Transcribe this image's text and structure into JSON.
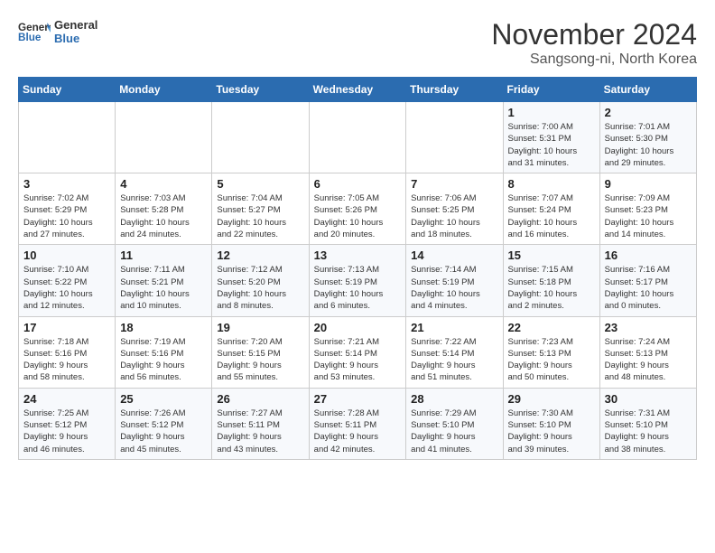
{
  "logo": {
    "line1": "General",
    "line2": "Blue"
  },
  "title": "November 2024",
  "location": "Sangsong-ni, North Korea",
  "days_of_week": [
    "Sunday",
    "Monday",
    "Tuesday",
    "Wednesday",
    "Thursday",
    "Friday",
    "Saturday"
  ],
  "weeks": [
    [
      {
        "day": "",
        "info": ""
      },
      {
        "day": "",
        "info": ""
      },
      {
        "day": "",
        "info": ""
      },
      {
        "day": "",
        "info": ""
      },
      {
        "day": "",
        "info": ""
      },
      {
        "day": "1",
        "info": "Sunrise: 7:00 AM\nSunset: 5:31 PM\nDaylight: 10 hours\nand 31 minutes."
      },
      {
        "day": "2",
        "info": "Sunrise: 7:01 AM\nSunset: 5:30 PM\nDaylight: 10 hours\nand 29 minutes."
      }
    ],
    [
      {
        "day": "3",
        "info": "Sunrise: 7:02 AM\nSunset: 5:29 PM\nDaylight: 10 hours\nand 27 minutes."
      },
      {
        "day": "4",
        "info": "Sunrise: 7:03 AM\nSunset: 5:28 PM\nDaylight: 10 hours\nand 24 minutes."
      },
      {
        "day": "5",
        "info": "Sunrise: 7:04 AM\nSunset: 5:27 PM\nDaylight: 10 hours\nand 22 minutes."
      },
      {
        "day": "6",
        "info": "Sunrise: 7:05 AM\nSunset: 5:26 PM\nDaylight: 10 hours\nand 20 minutes."
      },
      {
        "day": "7",
        "info": "Sunrise: 7:06 AM\nSunset: 5:25 PM\nDaylight: 10 hours\nand 18 minutes."
      },
      {
        "day": "8",
        "info": "Sunrise: 7:07 AM\nSunset: 5:24 PM\nDaylight: 10 hours\nand 16 minutes."
      },
      {
        "day": "9",
        "info": "Sunrise: 7:09 AM\nSunset: 5:23 PM\nDaylight: 10 hours\nand 14 minutes."
      }
    ],
    [
      {
        "day": "10",
        "info": "Sunrise: 7:10 AM\nSunset: 5:22 PM\nDaylight: 10 hours\nand 12 minutes."
      },
      {
        "day": "11",
        "info": "Sunrise: 7:11 AM\nSunset: 5:21 PM\nDaylight: 10 hours\nand 10 minutes."
      },
      {
        "day": "12",
        "info": "Sunrise: 7:12 AM\nSunset: 5:20 PM\nDaylight: 10 hours\nand 8 minutes."
      },
      {
        "day": "13",
        "info": "Sunrise: 7:13 AM\nSunset: 5:19 PM\nDaylight: 10 hours\nand 6 minutes."
      },
      {
        "day": "14",
        "info": "Sunrise: 7:14 AM\nSunset: 5:19 PM\nDaylight: 10 hours\nand 4 minutes."
      },
      {
        "day": "15",
        "info": "Sunrise: 7:15 AM\nSunset: 5:18 PM\nDaylight: 10 hours\nand 2 minutes."
      },
      {
        "day": "16",
        "info": "Sunrise: 7:16 AM\nSunset: 5:17 PM\nDaylight: 10 hours\nand 0 minutes."
      }
    ],
    [
      {
        "day": "17",
        "info": "Sunrise: 7:18 AM\nSunset: 5:16 PM\nDaylight: 9 hours\nand 58 minutes."
      },
      {
        "day": "18",
        "info": "Sunrise: 7:19 AM\nSunset: 5:16 PM\nDaylight: 9 hours\nand 56 minutes."
      },
      {
        "day": "19",
        "info": "Sunrise: 7:20 AM\nSunset: 5:15 PM\nDaylight: 9 hours\nand 55 minutes."
      },
      {
        "day": "20",
        "info": "Sunrise: 7:21 AM\nSunset: 5:14 PM\nDaylight: 9 hours\nand 53 minutes."
      },
      {
        "day": "21",
        "info": "Sunrise: 7:22 AM\nSunset: 5:14 PM\nDaylight: 9 hours\nand 51 minutes."
      },
      {
        "day": "22",
        "info": "Sunrise: 7:23 AM\nSunset: 5:13 PM\nDaylight: 9 hours\nand 50 minutes."
      },
      {
        "day": "23",
        "info": "Sunrise: 7:24 AM\nSunset: 5:13 PM\nDaylight: 9 hours\nand 48 minutes."
      }
    ],
    [
      {
        "day": "24",
        "info": "Sunrise: 7:25 AM\nSunset: 5:12 PM\nDaylight: 9 hours\nand 46 minutes."
      },
      {
        "day": "25",
        "info": "Sunrise: 7:26 AM\nSunset: 5:12 PM\nDaylight: 9 hours\nand 45 minutes."
      },
      {
        "day": "26",
        "info": "Sunrise: 7:27 AM\nSunset: 5:11 PM\nDaylight: 9 hours\nand 43 minutes."
      },
      {
        "day": "27",
        "info": "Sunrise: 7:28 AM\nSunset: 5:11 PM\nDaylight: 9 hours\nand 42 minutes."
      },
      {
        "day": "28",
        "info": "Sunrise: 7:29 AM\nSunset: 5:10 PM\nDaylight: 9 hours\nand 41 minutes."
      },
      {
        "day": "29",
        "info": "Sunrise: 7:30 AM\nSunset: 5:10 PM\nDaylight: 9 hours\nand 39 minutes."
      },
      {
        "day": "30",
        "info": "Sunrise: 7:31 AM\nSunset: 5:10 PM\nDaylight: 9 hours\nand 38 minutes."
      }
    ]
  ]
}
